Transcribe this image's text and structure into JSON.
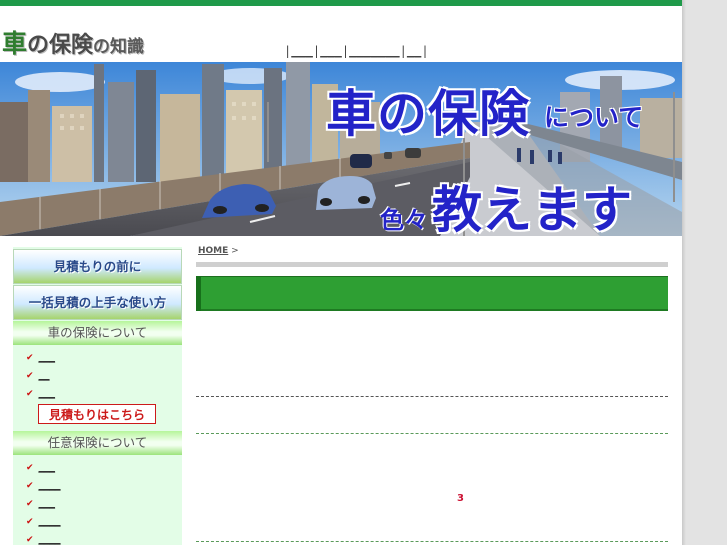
{
  "site": {
    "logo": {
      "part1": "車",
      "part2": "の",
      "part3": "保険",
      "part4": "の",
      "part5": "知識"
    },
    "top_links": [
      "___",
      "___",
      "_______",
      "__"
    ]
  },
  "banner": {
    "headline_big": "車の保険",
    "headline_small": "について",
    "sub_small": "色々",
    "sub_big": "教えます"
  },
  "sidebar": {
    "nav_buttons": [
      "見積もりの前に",
      "一括見積の上手な使い方"
    ],
    "section1": {
      "title": "車の保険について",
      "items": [
        "___",
        "__",
        "___"
      ]
    },
    "quote_button": "見積もりはこちら",
    "section2": {
      "title": "任意保険について",
      "items": [
        "___",
        "____",
        "___",
        "____",
        "____"
      ]
    }
  },
  "main": {
    "breadcrumb": {
      "home": "HOME",
      "sep": ">"
    },
    "page_title": "",
    "marker": "3"
  },
  "colors": {
    "accent_green": "#2e9f33",
    "text_blue": "#2323c8",
    "quote_red": "#cc1a1a"
  }
}
